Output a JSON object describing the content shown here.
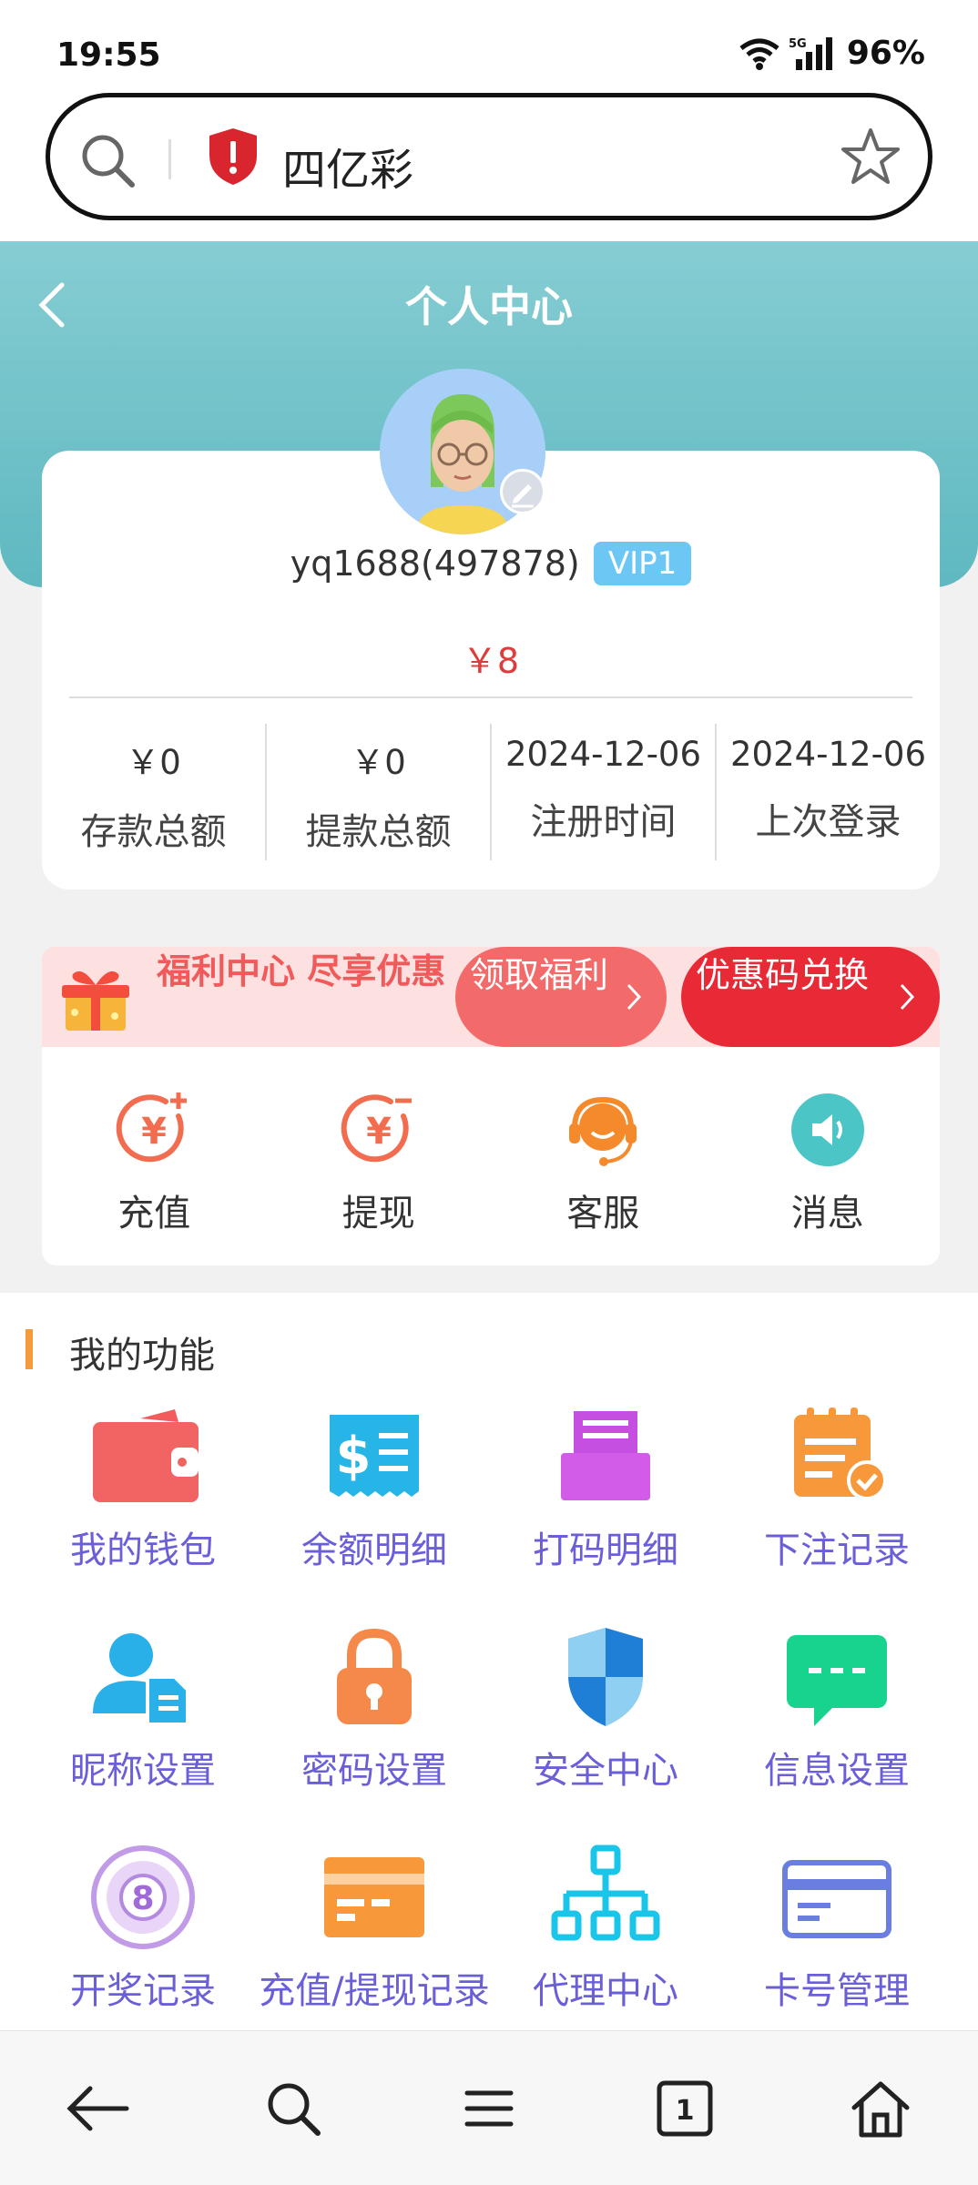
{
  "status_bar": {
    "time": "19:55",
    "network": "5G",
    "battery": "96%"
  },
  "browser": {
    "site_title": "四亿彩"
  },
  "header": {
    "title": "个人中心"
  },
  "profile": {
    "username": "yq1688(497878)",
    "vip": "VIP1",
    "balance": "￥8",
    "stats": [
      {
        "value": "￥0",
        "label": "存款总额"
      },
      {
        "value": "￥0",
        "label": "提款总额"
      },
      {
        "value": "2024-12-06",
        "label": "注册时间"
      },
      {
        "value": "2024-12-06",
        "label": "上次登录"
      }
    ]
  },
  "promo": {
    "text": "福利中心 尽享优惠",
    "button_1": "领取福利",
    "button_2": "优惠码兑换"
  },
  "quick_actions": [
    {
      "label": "充值",
      "icon": "deposit-icon",
      "color": "#f26d4f"
    },
    {
      "label": "提现",
      "icon": "withdraw-icon",
      "color": "#f26d4f"
    },
    {
      "label": "客服",
      "icon": "customer-service-icon",
      "color": "#f58a2c"
    },
    {
      "label": "消息",
      "icon": "speaker-icon",
      "color": "#4bc5c6"
    }
  ],
  "functions": {
    "title": "我的功能",
    "items": [
      {
        "label": "我的钱包",
        "icon": "wallet-icon"
      },
      {
        "label": "余额明细",
        "icon": "receipt-icon"
      },
      {
        "label": "打码明细",
        "icon": "printer-icon"
      },
      {
        "label": "下注记录",
        "icon": "clipboard-check-icon"
      },
      {
        "label": "昵称设置",
        "icon": "user-doc-icon"
      },
      {
        "label": "密码设置",
        "icon": "lock-icon"
      },
      {
        "label": "安全中心",
        "icon": "shield-icon"
      },
      {
        "label": "信息设置",
        "icon": "chat-icon"
      },
      {
        "label": "开奖记录",
        "icon": "lottery-ball-icon"
      },
      {
        "label": "充值/提现记录",
        "icon": "card-icon"
      },
      {
        "label": "代理中心",
        "icon": "org-chart-icon"
      },
      {
        "label": "卡号管理",
        "icon": "bank-card-icon"
      }
    ]
  },
  "colors": {
    "header": "#6cc0c7",
    "accent_red": "#e82a36",
    "function_label": "#6a5fd8"
  }
}
